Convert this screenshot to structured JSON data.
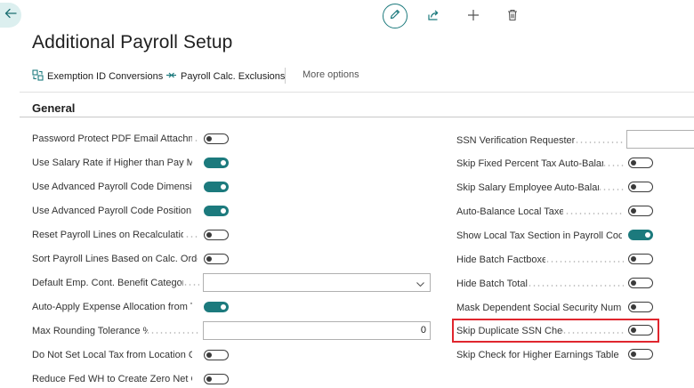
{
  "page": {
    "title": "Additional Payroll Setup",
    "section_title": "General"
  },
  "icons": {
    "back": "arrow-left-icon",
    "edit": "pencil-icon",
    "share": "share-icon",
    "new": "plus-icon",
    "delete": "trash-icon"
  },
  "actions": {
    "exemption": "Exemption ID Conversions",
    "exclusions": "Payroll Calc. Exclusions",
    "more": "More options"
  },
  "colors": {
    "accent": "#1c7a7d",
    "highlight": "#e0262e"
  },
  "left_fields": [
    {
      "label": "Password Protect PDF Email Attachme...",
      "type": "toggle",
      "on": false
    },
    {
      "label": "Use Salary Rate if Higher than Pay Ma...",
      "type": "toggle",
      "on": true
    },
    {
      "label": "Use Advanced Payroll Code Dimensions",
      "type": "toggle",
      "on": true
    },
    {
      "label": "Use Advanced Payroll Code Position / ...",
      "type": "toggle",
      "on": true
    },
    {
      "label": "Reset Payroll Lines on Recalculation",
      "type": "toggle",
      "on": false
    },
    {
      "label": "Sort Payroll Lines Based on Calc. Order",
      "type": "toggle",
      "on": false
    },
    {
      "label": "Default Emp. Cont. Benefit Category",
      "type": "select",
      "value": ""
    },
    {
      "label": "Auto-Apply Expense Allocation from T...",
      "type": "toggle",
      "on": true
    },
    {
      "label": "Max Rounding Tolerance %",
      "type": "number",
      "value": "0"
    },
    {
      "label": "Do Not Set Local Tax from Location C...",
      "type": "toggle",
      "on": false
    },
    {
      "label": "Reduce Fed WH to Create Zero Net C...",
      "type": "toggle",
      "on": false
    }
  ],
  "right_fields": [
    {
      "label": "SSN Verification Requester ID",
      "type": "text",
      "value": ""
    },
    {
      "label": "Skip Fixed Percent Tax Auto-Balance",
      "type": "toggle",
      "on": false
    },
    {
      "label": "Skip Salary Employee Auto-Balance",
      "type": "toggle",
      "on": false
    },
    {
      "label": "Auto-Balance Local Taxes",
      "type": "toggle",
      "on": false
    },
    {
      "label": "Show Local Tax Section in Payroll Cod...",
      "type": "toggle",
      "on": true
    },
    {
      "label": "Hide Batch Factboxes",
      "type": "toggle",
      "on": false
    },
    {
      "label": "Hide Batch Totals",
      "type": "toggle",
      "on": false
    },
    {
      "label": "Mask Dependent Social Security Num...",
      "type": "toggle",
      "on": false
    },
    {
      "label": "Skip Duplicate SSN Check",
      "type": "toggle",
      "on": false,
      "highlighted": true
    },
    {
      "label": "Skip Check for Higher Earnings Table ...",
      "type": "toggle",
      "on": false
    }
  ]
}
